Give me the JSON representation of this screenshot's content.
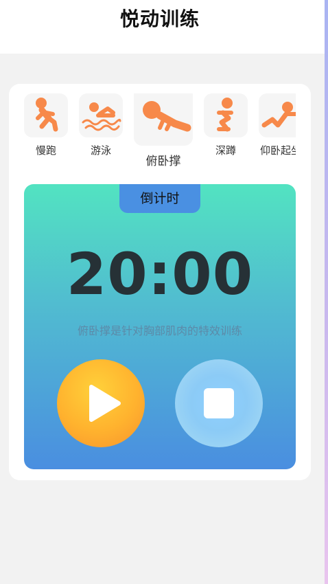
{
  "header": {
    "title": "悦动训练"
  },
  "exercises": [
    {
      "label": "慢跑",
      "icon": "jogging-icon"
    },
    {
      "label": "游泳",
      "icon": "swimming-icon"
    },
    {
      "label": "俯卧撑",
      "icon": "pushup-icon",
      "selected": true
    },
    {
      "label": "深蹲",
      "icon": "squat-icon"
    },
    {
      "label": "仰卧起坐",
      "icon": "situp-icon"
    }
  ],
  "timer": {
    "mode_label": "倒计时",
    "time": "20:00",
    "description": "俯卧撑是针对胸部肌肉的特效训练"
  },
  "controls": {
    "play_icon": "play-icon",
    "stop_icon": "stop-icon"
  },
  "colors": {
    "accent_orange": "#f7894a",
    "tab_blue": "#4a90e2",
    "panel_top": "#52e3c1",
    "panel_bottom": "#4a8ee0"
  }
}
